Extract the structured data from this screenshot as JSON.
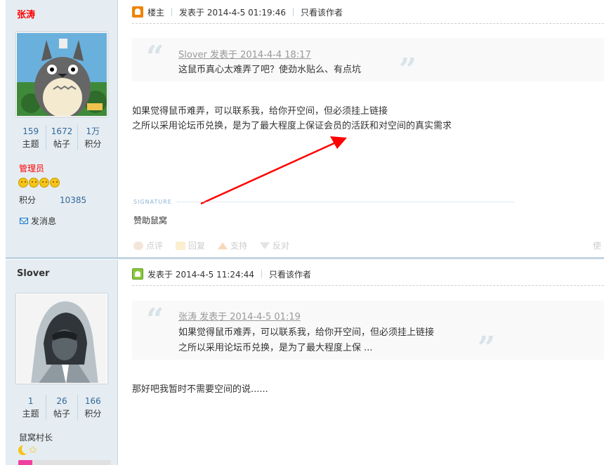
{
  "post1": {
    "author": "张涛",
    "stats": [
      {
        "num": "159",
        "label": "主题"
      },
      {
        "num": "1672",
        "label": "帖子"
      },
      {
        "num": "1万",
        "label": "积分"
      }
    ],
    "group": "管理员",
    "credits_label": "积分",
    "credits_value": "10385",
    "send_msg": "发消息",
    "owner_label": "楼主",
    "posted_at": "发表于 2014-4-5 01:19:46",
    "only_author": "只看该作者",
    "quote_source": "Slover 发表于 2014-4-4 18:17",
    "quote_lines": [
      "这鼠币真心太难弄了吧？使劲水贴么、有点坑"
    ],
    "body_lines": [
      "如果觉得鼠币难弄，可以联系我，给你开空间，但必须挂上链接",
      "之所以采用论坛币兑换，是为了最大程度上保证会员的活跃和对空间的真实需求"
    ],
    "signature_label": "SIGNATURE",
    "signature_text": "赞助鼠窝",
    "actions": [
      "点评",
      "回复",
      "支持",
      "反对"
    ],
    "use_text": "使"
  },
  "post2": {
    "author": "Slover",
    "stats": [
      {
        "num": "1",
        "label": "主题"
      },
      {
        "num": "26",
        "label": "帖子"
      },
      {
        "num": "166",
        "label": "积分"
      }
    ],
    "group": "鼠窝村长",
    "posted_at": "发表于 2014-4-5 11:24:44",
    "only_author": "只看该作者",
    "quote_source": "张涛 发表于 2014-4-5 01:19",
    "quote_lines": [
      "如果觉得鼠币难弄，可以联系我，给你开空间，但必须挂上链接",
      "之所以采用论坛币兑换，是为了最大程度上保 ..."
    ],
    "body_lines": [
      "那好吧我暂时不需要空间的说......"
    ]
  },
  "colors": {
    "admin_group": "#ff0000",
    "author_name_1": "#ff0000",
    "author_name_2": "#333333",
    "stat_num": "#336699",
    "arrow": "#ff0000"
  },
  "icons": {
    "owner": "owner-icon",
    "online": "online-icon",
    "mail": "mail-icon",
    "rank_faces": "smiley-face-icon",
    "rank_moon": "moon-icon"
  }
}
